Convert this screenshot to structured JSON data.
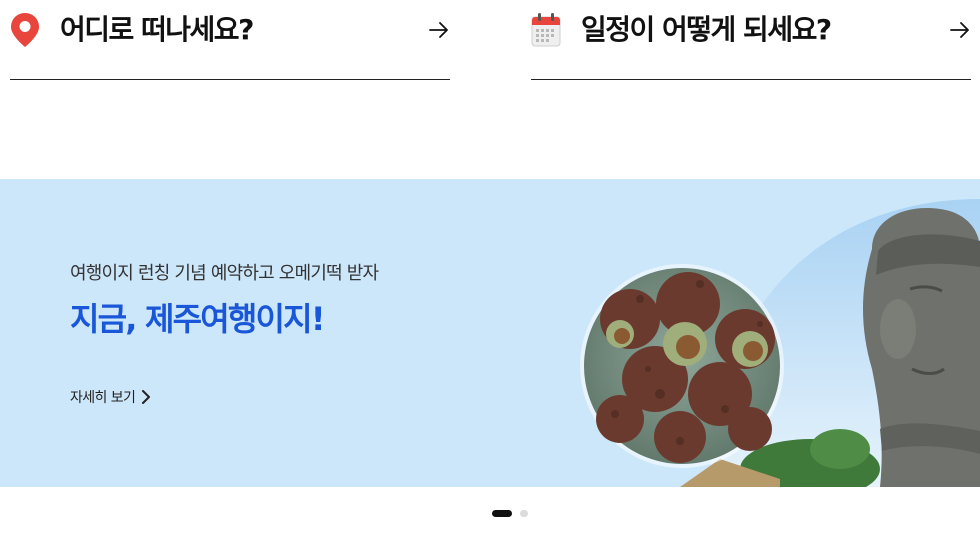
{
  "search": {
    "where": {
      "label": "어디로 떠나세요?",
      "icon": "location-pin-icon"
    },
    "when": {
      "label": "일정이 어떻게 되세요?",
      "icon": "calendar-icon"
    },
    "arrow_icon": "arrow-right-icon"
  },
  "banner": {
    "subtitle": "여행이지 런칭 기념 예약하고 오메기떡 받자",
    "headline": "지금, 제주여행이지!",
    "more_label": "자세히 보기",
    "background_color": "#cde7fa",
    "headline_color": "#1a57d8"
  },
  "pager": {
    "total": 2,
    "active_index": 0
  }
}
